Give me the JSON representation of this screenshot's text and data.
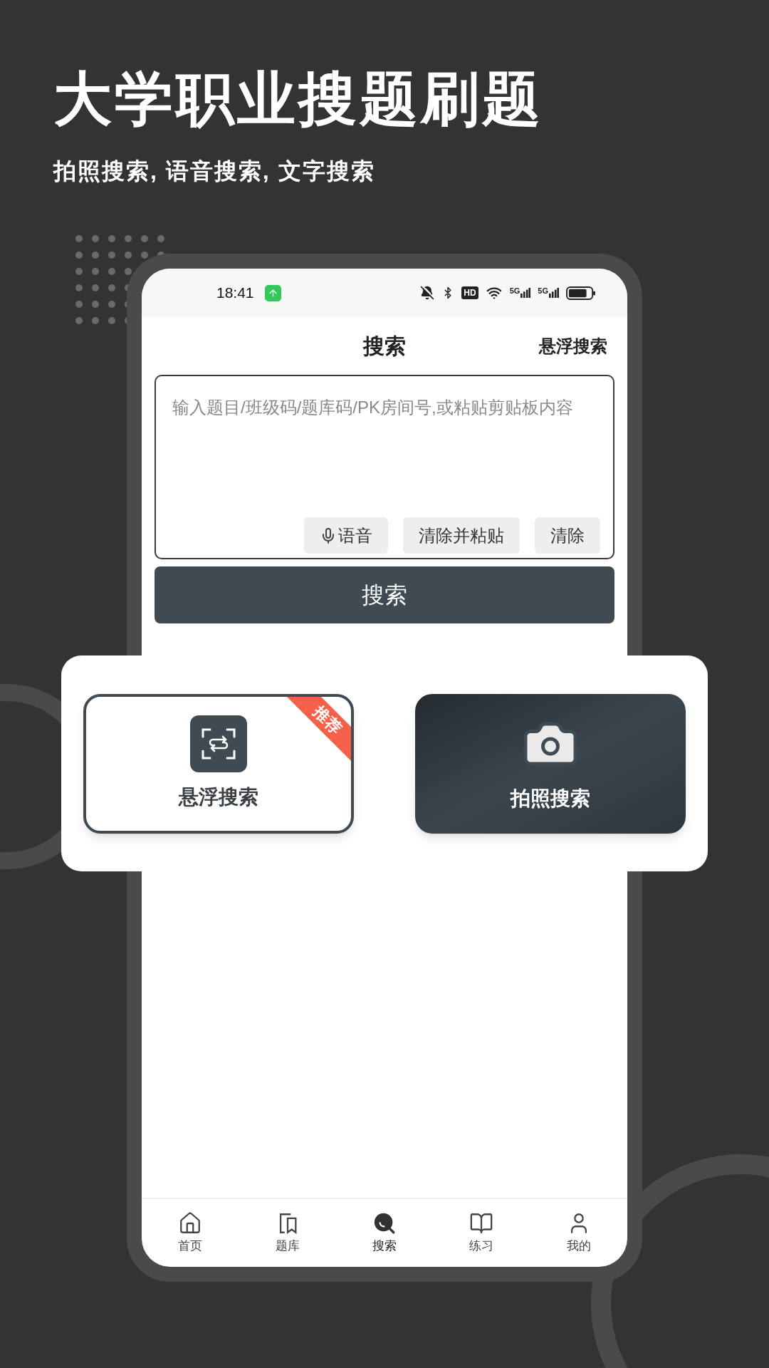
{
  "headline": "大学职业搜题刷题",
  "subheadline": "拍照搜索, 语音搜索, 文字搜索",
  "status_bar": {
    "time": "18:41",
    "hd_label": "HD",
    "signals": [
      "5G",
      "5G"
    ]
  },
  "header": {
    "title": "搜索",
    "action": "悬浮搜索"
  },
  "search_box": {
    "placeholder": "输入题目/班级码/题库码/PK房间号,或粘贴剪贴板内容",
    "buttons": [
      {
        "kind": "voice",
        "label": "语音"
      },
      {
        "kind": "plain",
        "label": "清除并粘贴"
      },
      {
        "kind": "plain",
        "label": "清除"
      }
    ]
  },
  "search_button": "搜索",
  "modes": [
    {
      "kind": "float",
      "label": "悬浮搜索",
      "badge": "推荐"
    },
    {
      "kind": "photo",
      "label": "拍照搜索"
    }
  ],
  "nav": [
    {
      "kind": "home",
      "label": "首页",
      "selected": false
    },
    {
      "kind": "bank",
      "label": "题库",
      "selected": false
    },
    {
      "kind": "search",
      "label": "搜索",
      "selected": true
    },
    {
      "kind": "practice",
      "label": "练习",
      "selected": false
    },
    {
      "kind": "me",
      "label": "我的",
      "selected": false
    }
  ]
}
